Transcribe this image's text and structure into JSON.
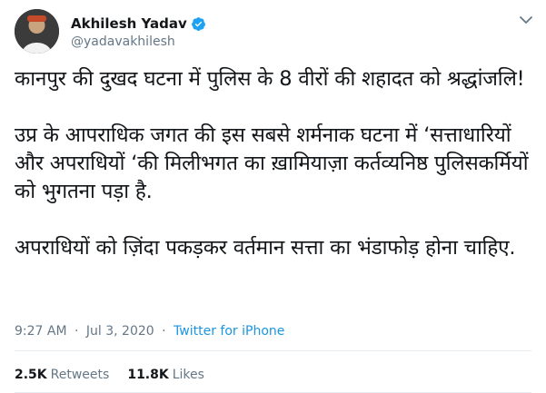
{
  "author": {
    "display_name": "Akhilesh Yadav",
    "handle": "@yadavakhilesh",
    "verified_icon": "verified-badge-icon",
    "verified_color": "#1da1f2"
  },
  "tweet": {
    "paragraphs": [
      "कानपुर की दुखद घटना में पुलिस के 8 वीरों की शहादत को श्रद्धांजलि!",
      "उप्र के आपराधिक जगत की इस सबसे शर्मनाक घटना में ‘सत्ताधारियों और अपराधियों ‘की मिलीभगत का ख़ामियाज़ा कर्तव्यनिष्ठ पुलिसकर्मियों को भुगतना पड़ा है.",
      "अपराधियों को ज़िंदा पकड़कर वर्तमान सत्ता का भंडाफोड़ होना चाहिए."
    ]
  },
  "meta": {
    "time": "9:27 AM",
    "separator": "·",
    "date": "Jul 3, 2020",
    "source": "Twitter for iPhone"
  },
  "stats": {
    "retweets_count": "2.5K",
    "retweets_label": "Retweets",
    "likes_count": "11.8K",
    "likes_label": "Likes"
  },
  "icons": {
    "more": "chevron-down-icon"
  }
}
